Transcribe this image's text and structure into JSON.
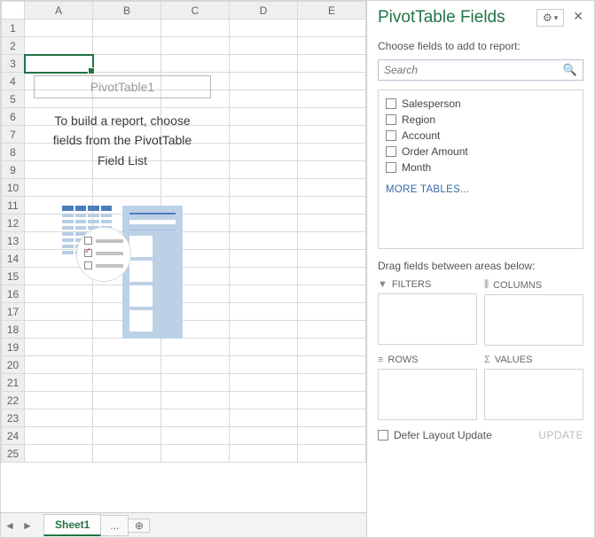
{
  "columns": [
    "A",
    "B",
    "C",
    "D",
    "E"
  ],
  "rows_count": 25,
  "selected_cell": {
    "row": 3,
    "col": 0
  },
  "pivot_placeholder": {
    "title": "PivotTable1",
    "line1": "To build a report, choose",
    "line2": "fields from the PivotTable",
    "line3": "Field List"
  },
  "tabs": {
    "active": "Sheet1",
    "overflow": "...",
    "add_glyph": "⊕"
  },
  "nav": {
    "prev": "◄",
    "next": "►"
  },
  "pane": {
    "title": "PivotTable Fields",
    "gear": "⚙",
    "gear_caret": "▾",
    "close": "✕",
    "subtitle": "Choose fields to add to report:",
    "search_placeholder": "Search",
    "search_icon": "🔍",
    "fields": [
      "Salesperson",
      "Region",
      "Account",
      "Order Amount",
      "Month"
    ],
    "more": "MORE TABLES...",
    "drag_label": "Drag fields between areas below:",
    "areas": {
      "filters": {
        "label": "FILTERS",
        "glyph": "▼"
      },
      "columns": {
        "label": "COLUMNS",
        "glyph": "⫼"
      },
      "rows": {
        "label": "ROWS",
        "glyph": "≡"
      },
      "values": {
        "label": "VALUES",
        "glyph": "Σ"
      }
    },
    "defer_label": "Defer Layout Update",
    "update_label": "UPDATE"
  }
}
